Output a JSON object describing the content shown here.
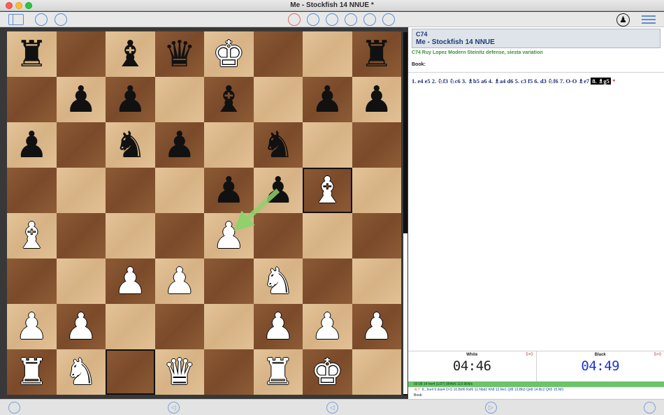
{
  "window": {
    "title": "Me - Stockfish 14 NNUE *"
  },
  "toolbar": {
    "pawn_icon_glyph": "♟"
  },
  "board": {
    "rows": [
      [
        {
          "p": "♜",
          "c": "b"
        },
        {
          "p": "",
          "c": ""
        },
        {
          "p": "♝",
          "c": "b"
        },
        {
          "p": "♛",
          "c": "b"
        },
        {
          "p": "♚",
          "c": "w"
        },
        {
          "p": "",
          "c": ""
        },
        {
          "p": "",
          "c": ""
        },
        {
          "p": "♜",
          "c": "b"
        }
      ],
      [
        {
          "p": "",
          "c": ""
        },
        {
          "p": "♟",
          "c": "b"
        },
        {
          "p": "♟",
          "c": "b"
        },
        {
          "p": "",
          "c": ""
        },
        {
          "p": "♝",
          "c": "b"
        },
        {
          "p": "",
          "c": ""
        },
        {
          "p": "♟",
          "c": "b"
        },
        {
          "p": "♟",
          "c": "b"
        }
      ],
      [
        {
          "p": "♟",
          "c": "b"
        },
        {
          "p": "",
          "c": ""
        },
        {
          "p": "♞",
          "c": "b"
        },
        {
          "p": "♟",
          "c": "b"
        },
        {
          "p": "",
          "c": ""
        },
        {
          "p": "♞",
          "c": "b"
        },
        {
          "p": "",
          "c": ""
        },
        {
          "p": "",
          "c": ""
        }
      ],
      [
        {
          "p": "",
          "c": ""
        },
        {
          "p": "",
          "c": ""
        },
        {
          "p": "",
          "c": ""
        },
        {
          "p": "",
          "c": ""
        },
        {
          "p": "♟",
          "c": "b"
        },
        {
          "p": "♟",
          "c": "b"
        },
        {
          "p": "♝",
          "c": "w"
        },
        {
          "p": "",
          "c": ""
        }
      ],
      [
        {
          "p": "♝",
          "c": "w"
        },
        {
          "p": "",
          "c": ""
        },
        {
          "p": "",
          "c": ""
        },
        {
          "p": "",
          "c": ""
        },
        {
          "p": "♟",
          "c": "w"
        },
        {
          "p": "",
          "c": ""
        },
        {
          "p": "",
          "c": ""
        },
        {
          "p": "",
          "c": ""
        }
      ],
      [
        {
          "p": "",
          "c": ""
        },
        {
          "p": "",
          "c": ""
        },
        {
          "p": "♟",
          "c": "w"
        },
        {
          "p": "♟",
          "c": "w"
        },
        {
          "p": "",
          "c": ""
        },
        {
          "p": "♞",
          "c": "w"
        },
        {
          "p": "",
          "c": ""
        },
        {
          "p": "",
          "c": ""
        }
      ],
      [
        {
          "p": "♟",
          "c": "w"
        },
        {
          "p": "♟",
          "c": "w"
        },
        {
          "p": "",
          "c": ""
        },
        {
          "p": "",
          "c": ""
        },
        {
          "p": "",
          "c": ""
        },
        {
          "p": "♟",
          "c": "w"
        },
        {
          "p": "♟",
          "c": "w"
        },
        {
          "p": "♟",
          "c": "w"
        }
      ],
      [
        {
          "p": "♜",
          "c": "w"
        },
        {
          "p": "♞",
          "c": "w"
        },
        {
          "p": "",
          "c": ""
        },
        {
          "p": "♛",
          "c": "w"
        },
        {
          "p": "",
          "c": ""
        },
        {
          "p": "♜",
          "c": "w"
        },
        {
          "p": "♚",
          "c": "w"
        },
        {
          "p": "",
          "c": ""
        }
      ]
    ],
    "highlight_squares": [
      "g5",
      "c1"
    ],
    "arrow": {
      "from": "f5",
      "to": "e4",
      "color": "#8fd16c"
    }
  },
  "game": {
    "eco": "C74",
    "players": "Me - Stockfish 14 NNUE",
    "opening": "C74 Ruy Lopez Modern Steinitz defense, siesta variation",
    "book_label": "Book:",
    "moves_text": "1. e4 e5 2. ♘f3 ♘c6 3. ♗b5 a6 4. ♗a4 d6 5. c3 f5 6. d3 ♘f6 7. O-O ♗e7",
    "current_move": "8. ♗g5",
    "result": "*"
  },
  "clocks": {
    "white": {
      "name": "White",
      "increment": "5+0",
      "time": "04:46"
    },
    "black": {
      "name": "Black",
      "increment": "5+0",
      "time": "04:49"
    }
  },
  "engine": {
    "status": "00:08  14  fxe4  (1/27)  984kN  119.9kN/s",
    "score": "-0.7",
    "pv": "8...fxe4 9.dxe4 O-O 10.Bxf6 Rxf6 11.Nbd2 Kh8 12.Re1 Qf8 13.Bb3 Qe8 14.Bc2 Qh5 15.Nf1",
    "book_label": "Book:"
  },
  "colors": {
    "light_square": "#dcb98b",
    "dark_square": "#80502e",
    "accent_blue": "#5b8fd1",
    "engine_green": "#6bc46a",
    "black_clock": "#1a35d6"
  }
}
